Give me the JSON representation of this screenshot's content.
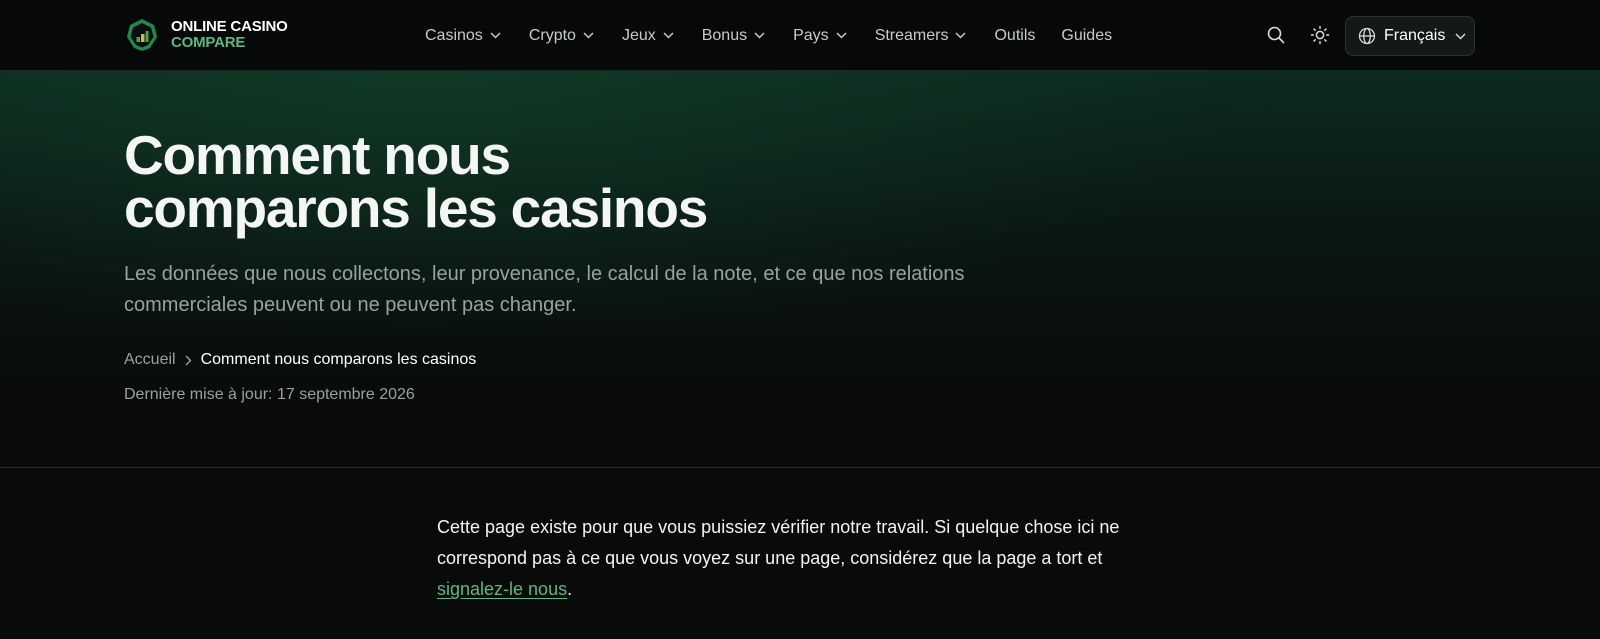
{
  "header": {
    "logo": {
      "line1": "ONLINE CASINO",
      "line2": "COMPARE"
    },
    "nav": [
      {
        "label": "Casinos",
        "dropdown": true
      },
      {
        "label": "Crypto",
        "dropdown": true
      },
      {
        "label": "Jeux",
        "dropdown": true
      },
      {
        "label": "Bonus",
        "dropdown": true
      },
      {
        "label": "Pays",
        "dropdown": true
      },
      {
        "label": "Streamers",
        "dropdown": true
      },
      {
        "label": "Outils",
        "dropdown": false
      },
      {
        "label": "Guides",
        "dropdown": false
      }
    ],
    "icons": {
      "search": "search-icon",
      "theme": "sun-icon",
      "language": "globe-icon"
    },
    "language": "Français"
  },
  "hero": {
    "title_line1": "Comment nous",
    "title_line2": "comparons les casinos",
    "subtitle": "Les données que nous collectons, leur provenance, le calcul de la note, et ce que nos relations commerciales peuvent ou ne peuvent pas changer.",
    "breadcrumb": {
      "home": "Accueil",
      "current": "Comment nous comparons les casinos"
    },
    "updated": "Dernière mise à jour: 17 septembre 2026"
  },
  "intro": {
    "text": "Cette page existe pour que vous puissiez vérifier notre travail. Si quelque chose ici ne correspond pas à ce que vous voyez sur une page, considérez que la page a tort et ",
    "link": "signalez-le nous",
    "end": "."
  },
  "colors": {
    "accent": "#5fb685",
    "background": "#090b0a",
    "hero_green": "#0d2a1f"
  }
}
